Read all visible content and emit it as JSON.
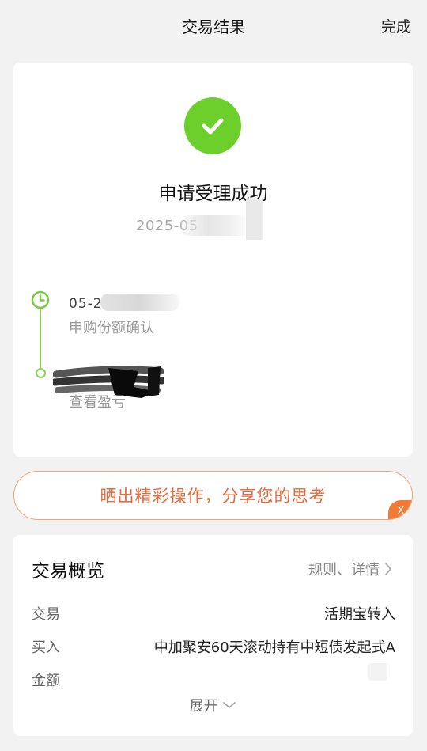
{
  "topbar": {
    "title": "交易结果",
    "done_label": "完成"
  },
  "result": {
    "status_title": "申请受理成功",
    "submit_date": "2025-05",
    "success_color": "#6ccf2b"
  },
  "timeline": {
    "steps": [
      {
        "date_text": "05-27 星",
        "label": "申购份额确认"
      },
      {
        "label": "查看盈亏"
      }
    ],
    "accent_color": "#8bd155"
  },
  "share": {
    "text": "晒出精彩操作，分享您的思考",
    "close_label": "X",
    "accent_color": "#e8693a"
  },
  "overview": {
    "title": "交易概览",
    "link_label": "规则、详情",
    "rows": [
      {
        "label": "交易",
        "value": "活期宝转入"
      },
      {
        "label": "买入",
        "value": "中加聚安60天滚动持有中短债发起式A"
      },
      {
        "label": "金额",
        "value": ""
      }
    ],
    "expand_label": "展开"
  }
}
